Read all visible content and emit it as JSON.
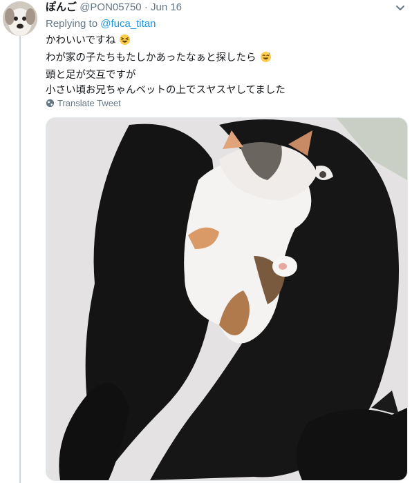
{
  "tweet": {
    "display_name": "ぽんご",
    "handle": "@PON05750",
    "separator": "·",
    "date": "Jun 16",
    "replying_prefix": "Replying to",
    "replying_mention": "@fuca_titan",
    "lines": [
      "かわいいですね",
      "わが家の子たちもたしかあったなぁと探したら",
      "頭と足が交互ですが",
      "小さい頃お兄ちゃんベットの上でスヤスヤしてました"
    ],
    "translate_label": "Translate Tweet"
  },
  "icons": {
    "avatar": "dog-avatar",
    "menu": "chevron-down-icon",
    "translate": "globe-icon",
    "emoji_1": "grinning-squinting-face-emoji",
    "emoji_2": "grinning-sweat-face-emoji"
  },
  "colors": {
    "link": "#1b95e0",
    "secondary_text": "#657786",
    "thread_line": "#ccd6dd"
  }
}
